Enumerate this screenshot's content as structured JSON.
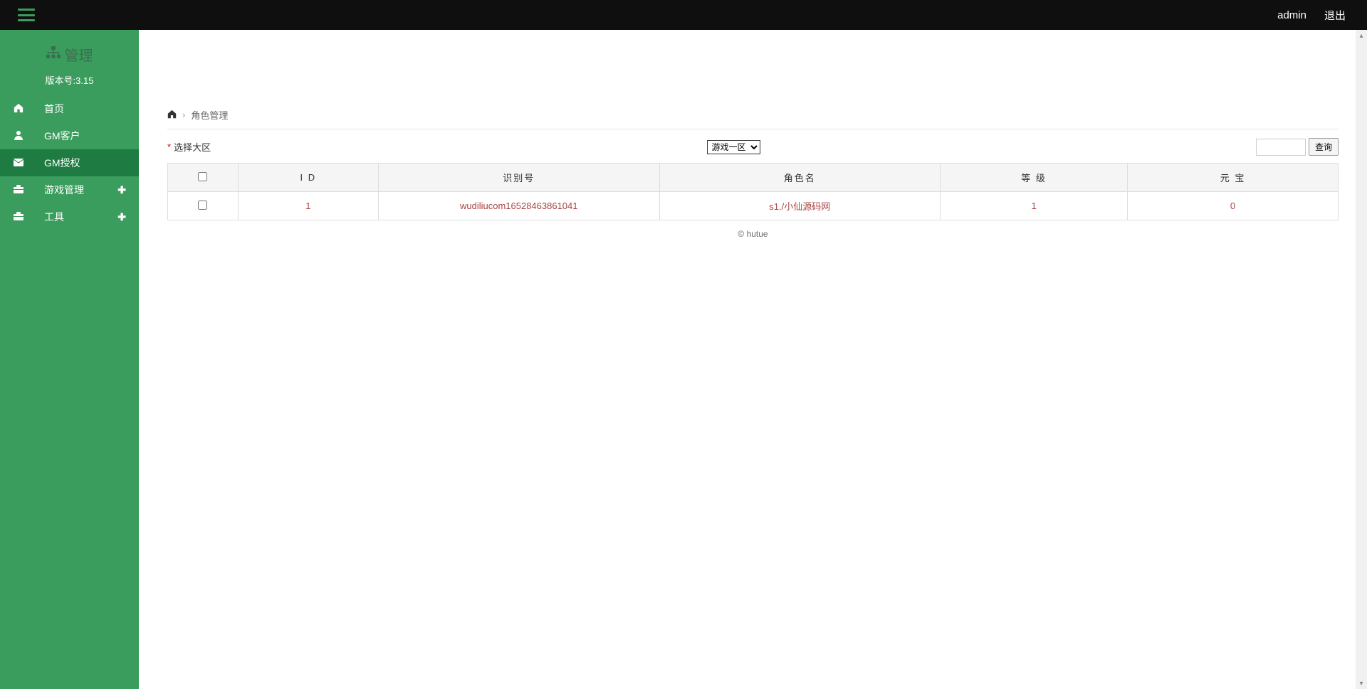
{
  "topbar": {
    "user": "admin",
    "logout": "退出"
  },
  "sidebar": {
    "title": "管理",
    "version": "版本号:3.15",
    "items": [
      {
        "label": "首页",
        "has_plus": false,
        "active": false
      },
      {
        "label": "GM客户",
        "has_plus": false,
        "active": false
      },
      {
        "label": "GM授权",
        "has_plus": false,
        "active": true
      },
      {
        "label": "游戏管理",
        "has_plus": true,
        "active": false
      },
      {
        "label": "工具",
        "has_plus": true,
        "active": false
      }
    ]
  },
  "breadcrumb": {
    "current": "角色管理"
  },
  "filter": {
    "label": "选择大区",
    "selected": "游戏一区",
    "search_button": "查询"
  },
  "table": {
    "headers": [
      "I D",
      "识别号",
      "角色名",
      "等 级",
      "元 宝"
    ],
    "rows": [
      {
        "id": "1",
        "identifier": "wudiliucom16528463861041",
        "role_name": "s1./小仙源码网",
        "level": "1",
        "ingot": "0"
      }
    ]
  },
  "footer": {
    "copyright": "© hutue"
  }
}
